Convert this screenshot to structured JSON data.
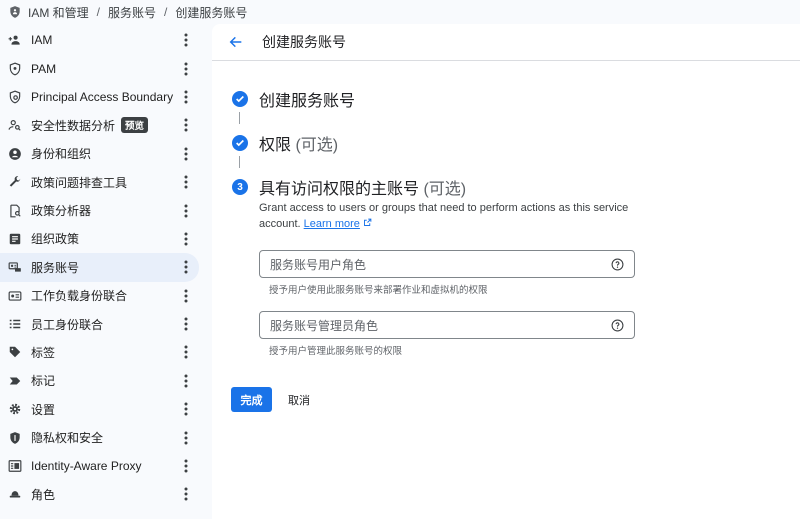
{
  "breadcrumb": {
    "items": [
      "IAM 和管理",
      "服务账号",
      "创建服务账号"
    ],
    "separator": "/"
  },
  "sidebar": {
    "items": [
      {
        "label": "IAM",
        "icon": "person-add-icon"
      },
      {
        "label": "PAM",
        "icon": "shield-icon"
      },
      {
        "label": "Principal Access Boundary",
        "icon": "policy-icon"
      },
      {
        "label": "安全性数据分析",
        "icon": "person-search-icon",
        "badge": "预览"
      },
      {
        "label": "身份和组织",
        "icon": "account-circle-icon"
      },
      {
        "label": "政策问题排查工具",
        "icon": "wrench-icon"
      },
      {
        "label": "政策分析器",
        "icon": "document-search-icon"
      },
      {
        "label": "组织政策",
        "icon": "list-doc-icon"
      },
      {
        "label": "服务账号",
        "icon": "service-account-icon",
        "active": true
      },
      {
        "label": "工作负载身份联合",
        "icon": "id-card-icon"
      },
      {
        "label": "员工身份联合",
        "icon": "bullet-list-icon"
      },
      {
        "label": "标签",
        "icon": "tag-icon"
      },
      {
        "label": "标记",
        "icon": "label-icon"
      },
      {
        "label": "设置",
        "icon": "gear-icon"
      },
      {
        "label": "隐私权和安全",
        "icon": "privacy-shield-icon"
      },
      {
        "label": "Identity-Aware Proxy",
        "icon": "proxy-icon"
      },
      {
        "label": "角色",
        "icon": "hat-icon"
      }
    ]
  },
  "header": {
    "title": "创建服务账号"
  },
  "steps": [
    {
      "title": "创建服务账号",
      "optional": "",
      "status": "done"
    },
    {
      "title": "权限",
      "optional": "(可选)",
      "status": "done"
    },
    {
      "title": "具有访问权限的主账号",
      "optional": "(可选)",
      "status": "current",
      "number": "3"
    }
  ],
  "step3": {
    "description": "Grant access to users or groups that need to perform actions as this service account.",
    "learn_more": "Learn more"
  },
  "fields": [
    {
      "placeholder": "服务账号用户角色",
      "hint": "授予用户使用此服务账号来部署作业和虚拟机的权限"
    },
    {
      "placeholder": "服务账号管理员角色",
      "hint": "授予用户管理此服务账号的权限"
    }
  ],
  "actions": {
    "done": "完成",
    "cancel": "取消"
  },
  "colors": {
    "primary": "#1a73e8",
    "active_nav": "#e8effa"
  }
}
